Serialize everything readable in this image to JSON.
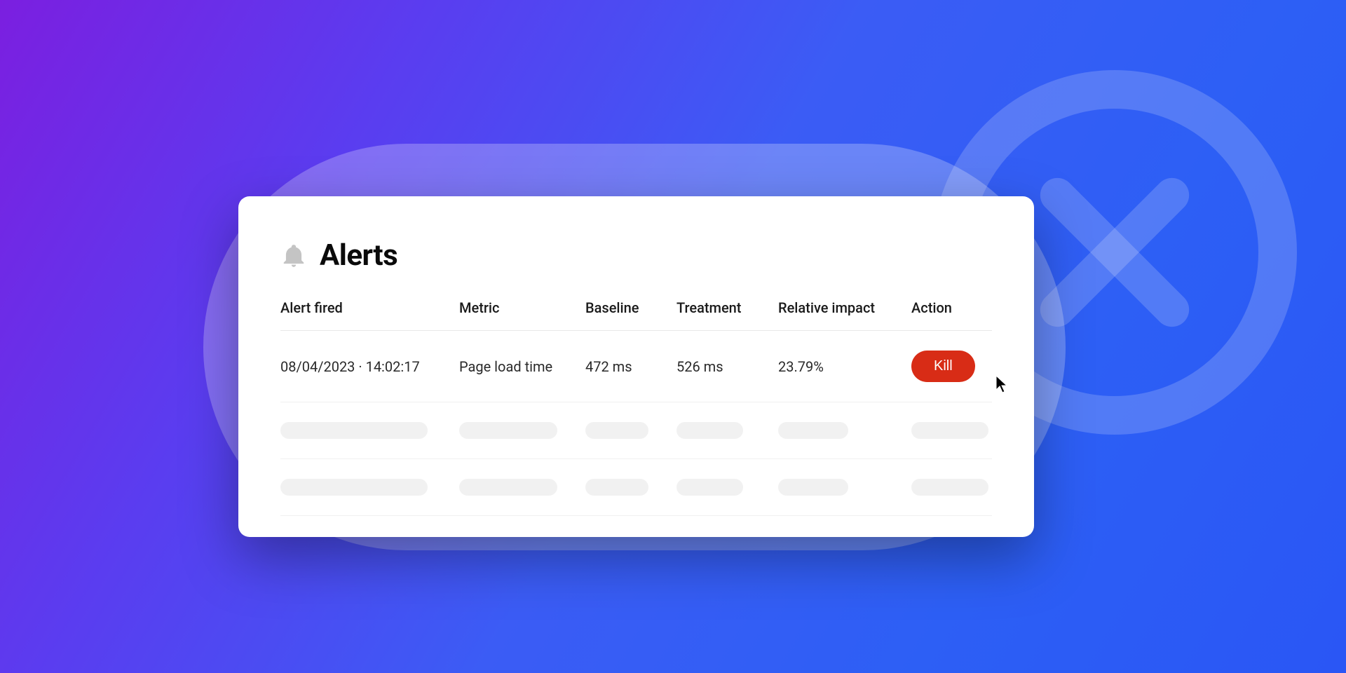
{
  "panel": {
    "title": "Alerts"
  },
  "columns": {
    "alert_fired": "Alert fired",
    "metric": "Metric",
    "baseline": "Baseline",
    "treatment": "Treatment",
    "relative_impact": "Relative impact",
    "action": "Action"
  },
  "rows": [
    {
      "alert_fired": "08/04/2023 · 14:02:17",
      "metric": "Page load time",
      "baseline": "472 ms",
      "treatment": "526 ms",
      "relative_impact": "23.79%",
      "action_label": "Kill"
    }
  ],
  "colors": {
    "kill_button": "#d82c16",
    "background_gradient_start": "#7b1fe0",
    "background_gradient_end": "#2a56f5"
  }
}
